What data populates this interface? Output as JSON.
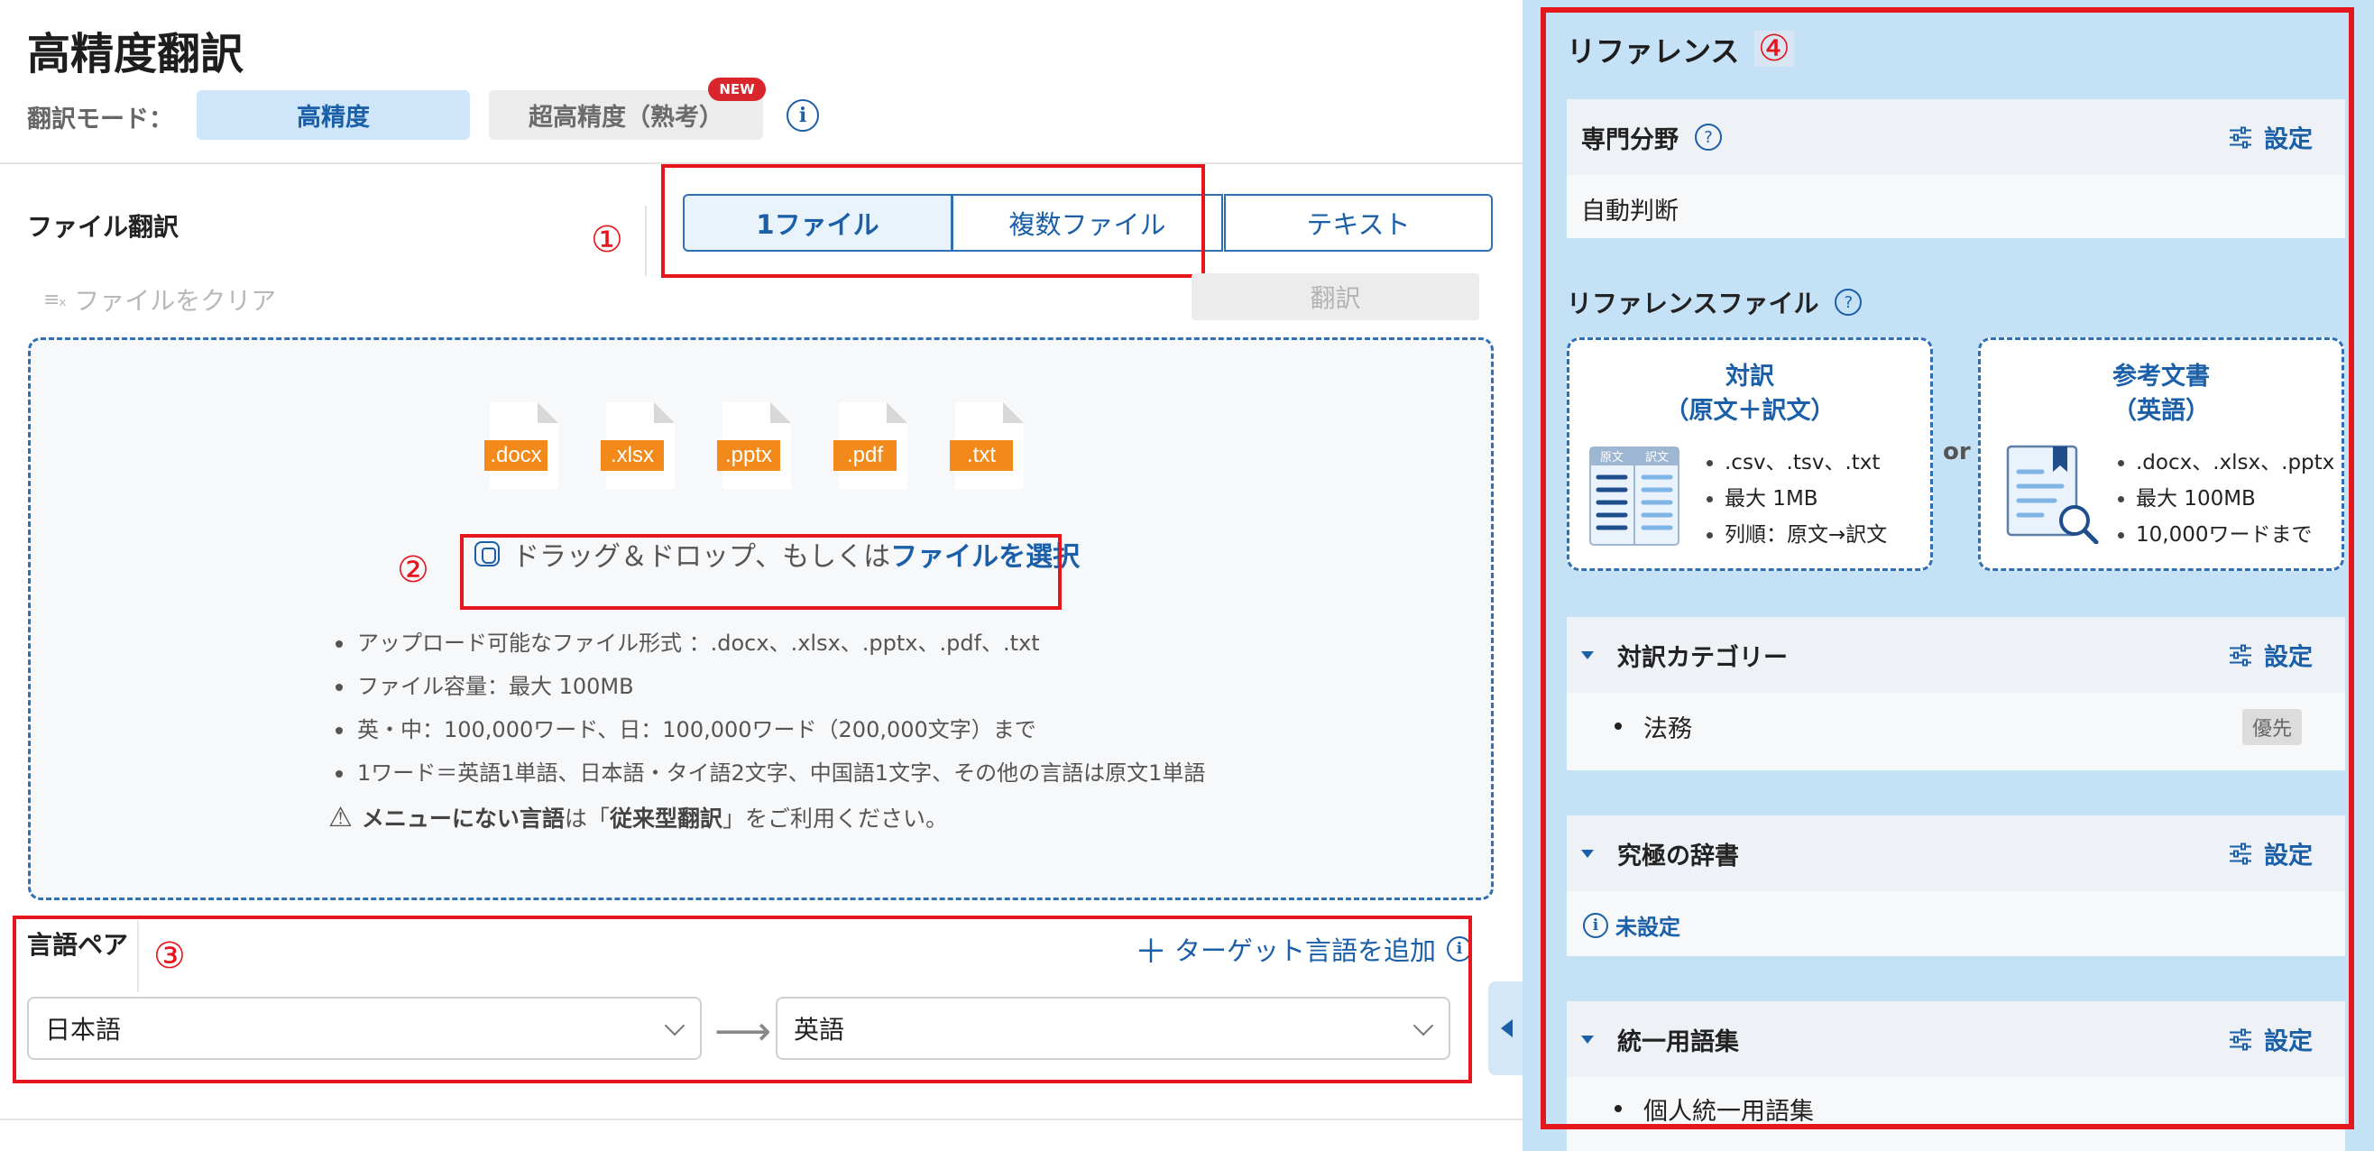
{
  "header": {
    "title": "高精度翻訳",
    "mode_label": "翻訳モード：",
    "mode_high": "高精度",
    "mode_ultra": "超高精度（熟考）",
    "new_badge": "NEW"
  },
  "file_section": {
    "title": "ファイル翻訳",
    "tabs": [
      "1ファイル",
      "複数ファイル",
      "テキスト"
    ],
    "clear_label": "ファイルをクリア",
    "translate_label": "翻訳",
    "file_types": [
      ".docx",
      ".xlsx",
      ".pptx",
      ".pdf",
      ".txt"
    ],
    "drag_text": "ドラッグ＆ドロップ、もしくは",
    "select_link": "ファイルを選択",
    "info": [
      "アップロード可能なファイル形式 ：.docx、.xlsx、.pptx、.pdf、.txt",
      "ファイル容量：最大 100MB",
      "英・中：100,000ワード、日：100,000ワード（200,000文字）まで",
      "1ワード＝英語1単語、日本語・タイ語2文字、中国語1文字、その他の言語は原文1単語"
    ],
    "warning_bold": "メニューにない言語",
    "warning_mid": "は「",
    "warning_bold2": "従来型翻訳",
    "warning_end": "」をご利用ください。"
  },
  "language_pair": {
    "title": "言語ペア",
    "add_target": "ターゲット言語を追加",
    "source": "日本語",
    "target": "英語"
  },
  "annotations": [
    "①",
    "②",
    "③",
    "④"
  ],
  "reference": {
    "title": "リファレンス",
    "setting_label": "設定",
    "specialty": {
      "label": "専門分野",
      "value": "自動判断"
    },
    "ref_file_title": "リファレンスファイル",
    "or_label": "or",
    "bilingual": {
      "title_line1": "対訳",
      "title_line2": "（原文＋訳文）",
      "icon_col1": "原文",
      "icon_col2": "訳文",
      "items": [
        ".csv、.tsv、.txt",
        "最大 1MB",
        "列順：原文→訳文"
      ]
    },
    "reference_doc": {
      "title_line1": "参考文書",
      "title_line2": "（英語）",
      "items": [
        ".docx、.xlsx、.pptx",
        "最大 100MB",
        "10,000ワードまで"
      ]
    },
    "category": {
      "label": "対訳カテゴリー",
      "item": "法務",
      "badge": "優先"
    },
    "dictionary": {
      "label": "究極の辞書",
      "value": "未設定"
    },
    "glossary": {
      "label": "統一用語集",
      "item": "個人統一用語集"
    }
  }
}
